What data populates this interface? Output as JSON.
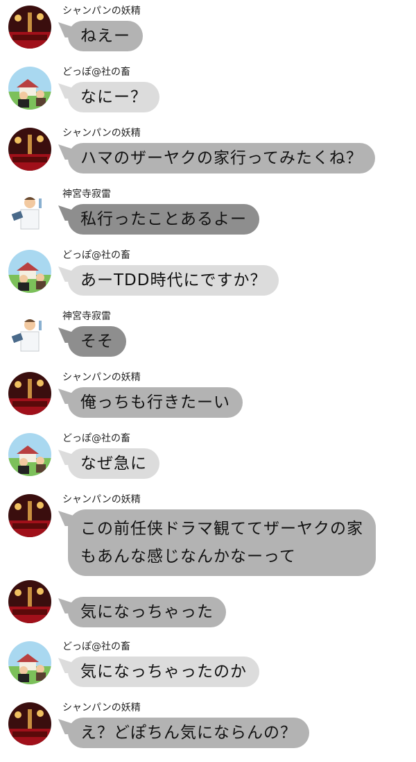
{
  "senders": {
    "champagne": "シャンパンの妖精",
    "doppo": "どっぽ@社の畜",
    "jinguji": "神宮寺寂雷"
  },
  "messages": [
    {
      "avatar": "champagne-avatar",
      "name": "シャンパンの妖精",
      "text": "ねえー",
      "shade": "#b3b3b3"
    },
    {
      "avatar": "doppo-avatar",
      "name": "どっぽ@社の畜",
      "text": "なにー？",
      "shade": "#dcdcdc"
    },
    {
      "avatar": "champagne-avatar",
      "name": "シャンパンの妖精",
      "text": "ハマのザーヤクの家行ってみたくね？",
      "shade": "#b3b3b3"
    },
    {
      "avatar": "jinguji-avatar",
      "name": "神宮寺寂雷",
      "text": "私行ったことあるよー",
      "shade": "#8e8e8e"
    },
    {
      "avatar": "doppo-avatar",
      "name": "どっぽ@社の畜",
      "text": "あーTDD時代にですか？",
      "shade": "#dcdcdc"
    },
    {
      "avatar": "jinguji-avatar",
      "name": "神宮寺寂雷",
      "text": "そそ",
      "shade": "#8e8e8e"
    },
    {
      "avatar": "champagne-avatar",
      "name": "シャンパンの妖精",
      "text": "俺っちも行きたーい",
      "shade": "#b3b3b3"
    },
    {
      "avatar": "doppo-avatar",
      "name": "どっぽ@社の畜",
      "text": "なぜ急に",
      "shade": "#dcdcdc"
    },
    {
      "avatar": "champagne-avatar",
      "name": "シャンパンの妖精",
      "text_line1": "この前任侠ドラマ観ててザーヤクの家",
      "text_line2": "もあんな感じなんかなーって",
      "shade": "#b3b3b3"
    },
    {
      "avatar": "champagne-avatar",
      "name": "",
      "text": "気になっちゃった",
      "shade": "#b3b3b3"
    },
    {
      "avatar": "doppo-avatar",
      "name": "どっぽ@社の畜",
      "text": "気になっちゃったのか",
      "shade": "#dcdcdc"
    },
    {
      "avatar": "champagne-avatar",
      "name": "シャンパンの妖精",
      "text": "え？どぽちん気にならんの？",
      "shade": "#b3b3b3"
    }
  ]
}
